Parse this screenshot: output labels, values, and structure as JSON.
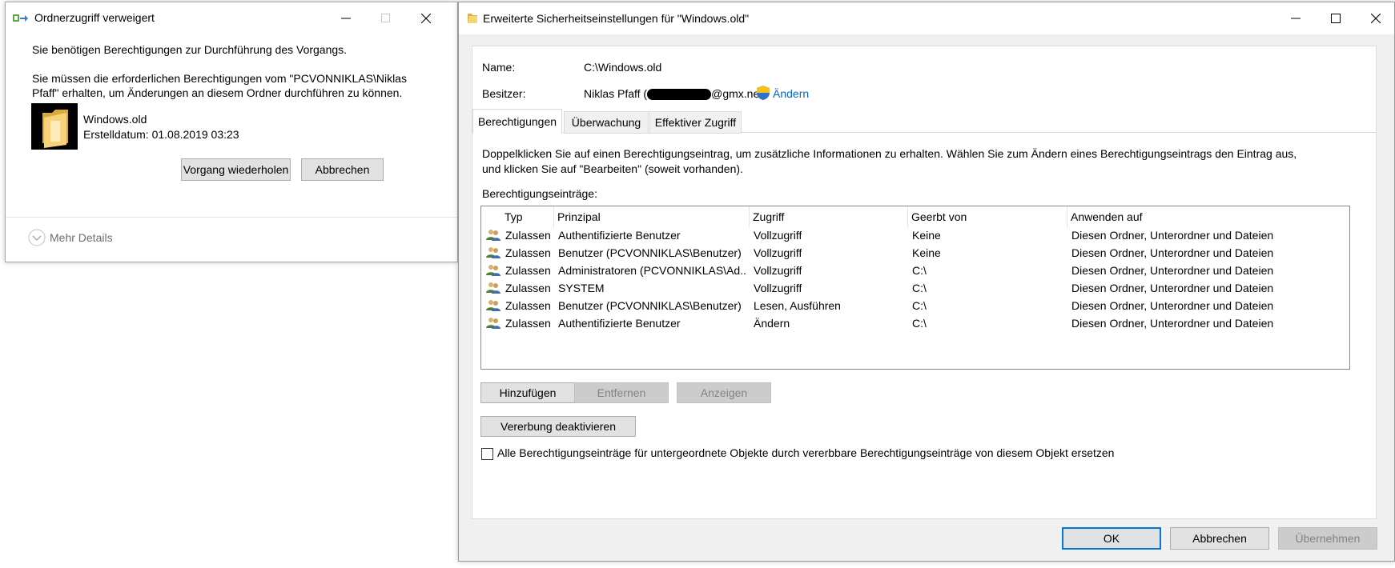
{
  "access_denied_dialog": {
    "title": "Ordnerzugriff verweigert",
    "message1": "Sie benötigen Berechtigungen zur Durchführung des Vorgangs.",
    "message2_line1": "Sie müssen die erforderlichen Berechtigungen vom \"PCVONNIKLAS\\Niklas",
    "message2_line2": "Pfaff\" erhalten, um Änderungen an diesem Ordner durchführen zu können.",
    "folder_name": "Windows.old",
    "folder_date": "Erstelldatum: 01.08.2019 03:23",
    "retry_label": "Vorgang wiederholen",
    "cancel_label": "Abbrechen",
    "more_details_label": "Mehr Details"
  },
  "security_dialog": {
    "title": "Erweiterte Sicherheitseinstellungen für \"Windows.old\"",
    "name_label": "Name:",
    "name_value": "C:\\Windows.old",
    "owner_label": "Besitzer:",
    "owner_value_prefix": "Niklas Pfaff (",
    "owner_value_suffix": "@gmx.net)",
    "change_owner_label": "Ändern",
    "tabs": [
      {
        "label": "Berechtigungen"
      },
      {
        "label": "Überwachung"
      },
      {
        "label": "Effektiver Zugriff"
      }
    ],
    "instructions_line1": "Doppelklicken Sie auf einen Berechtigungseintrag, um zusätzliche Informationen zu erhalten. Wählen Sie zum Ändern eines Berechtigungseintrags den Eintrag aus,",
    "instructions_line2": "und klicken Sie auf \"Bearbeiten\" (soweit vorhanden).",
    "entries_label": "Berechtigungseinträge:",
    "columns": [
      "Typ",
      "Prinzipal",
      "Zugriff",
      "Geerbt von",
      "Anwenden auf"
    ],
    "rows": [
      {
        "type": "Zulassen",
        "principal": "Authentifizierte Benutzer",
        "access": "Vollzugriff",
        "inherited": "Keine",
        "apply": "Diesen Ordner, Unterordner und Dateien"
      },
      {
        "type": "Zulassen",
        "principal": "Benutzer (PCVONNIKLAS\\Benutzer)",
        "access": "Vollzugriff",
        "inherited": "Keine",
        "apply": "Diesen Ordner, Unterordner und Dateien"
      },
      {
        "type": "Zulassen",
        "principal": "Administratoren (PCVONNIKLAS\\Ad...",
        "access": "Vollzugriff",
        "inherited": "C:\\",
        "apply": "Diesen Ordner, Unterordner und Dateien"
      },
      {
        "type": "Zulassen",
        "principal": "SYSTEM",
        "access": "Vollzugriff",
        "inherited": "C:\\",
        "apply": "Diesen Ordner, Unterordner und Dateien"
      },
      {
        "type": "Zulassen",
        "principal": "Benutzer (PCVONNIKLAS\\Benutzer)",
        "access": "Lesen, Ausführen",
        "inherited": "C:\\",
        "apply": "Diesen Ordner, Unterordner und Dateien"
      },
      {
        "type": "Zulassen",
        "principal": "Authentifizierte Benutzer",
        "access": "Ändern",
        "inherited": "C:\\",
        "apply": "Diesen Ordner, Unterordner und Dateien"
      }
    ],
    "add_label": "Hinzufügen",
    "remove_label": "Entfernen",
    "view_label": "Anzeigen",
    "disable_inheritance_label": "Vererbung deaktivieren",
    "replace_checkbox_label": "Alle Berechtigungseinträge für untergeordnete Objekte durch vererbbare Berechtigungseinträge von diesem Objekt ersetzen",
    "replace_checked": false,
    "ok_label": "OK",
    "cancel_label": "Abbrechen",
    "apply_label": "Übernehmen"
  },
  "colors": {
    "accent": "#0078d7",
    "link": "#0066cc",
    "disabled_text": "#838383"
  }
}
